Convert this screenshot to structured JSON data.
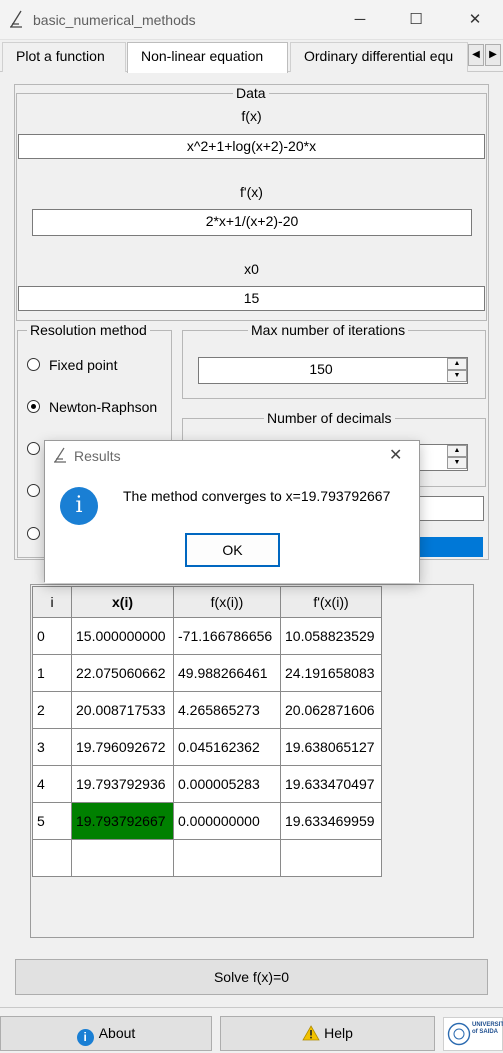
{
  "window": {
    "title": "basic_numerical_methods"
  },
  "tabs": [
    {
      "label": "Plot a function"
    },
    {
      "label": "Non-linear equation"
    },
    {
      "label": "Ordinary differential equ"
    }
  ],
  "data_group": {
    "legend": "Data",
    "fx_label": "f(x)",
    "fx_value": "x^2+1+log(x+2)-20*x",
    "dfx_label": "f'(x)",
    "dfx_value": "2*x+1/(x+2)-20",
    "x0_label": "x0",
    "x0_value": "15"
  },
  "resolution": {
    "legend": "Resolution method",
    "options": [
      {
        "label": "Fixed point",
        "checked": false
      },
      {
        "label": "Newton-Raphson",
        "checked": true
      }
    ]
  },
  "max_iter": {
    "legend": "Max number of iterations",
    "value": "150"
  },
  "decimals": {
    "legend": "Number of decimals"
  },
  "dialog": {
    "title": "Results",
    "message": "The method converges to x=19.793792667",
    "ok_label": "OK"
  },
  "table": {
    "headers": [
      "i",
      "x(i)",
      "f(x(i))",
      "f'(x(i))"
    ],
    "rows": [
      [
        "0",
        "15.000000000",
        "-71.166786656",
        "10.058823529"
      ],
      [
        "1",
        "22.075060662",
        "49.988266461",
        "24.191658083"
      ],
      [
        "2",
        "20.008717533",
        "4.265865273",
        "20.062871606"
      ],
      [
        "3",
        "19.796092672",
        "0.045162362",
        "19.638065127"
      ],
      [
        "4",
        "19.793792936",
        "0.000005283",
        "19.633470497"
      ],
      [
        "5",
        "19.793792667",
        "0.000000000",
        "19.633469959"
      ]
    ],
    "highlight_color": "#008000"
  },
  "buttons": {
    "solve": "Solve f(x)=0",
    "about": "About",
    "help": "Help"
  },
  "logo": {
    "text": "UNIVERSITY of SAIDA"
  },
  "colors": {
    "accent": "#0067c0",
    "progress": "#0078d7",
    "info": "#1a7fd4",
    "warning": "#f2c200"
  }
}
